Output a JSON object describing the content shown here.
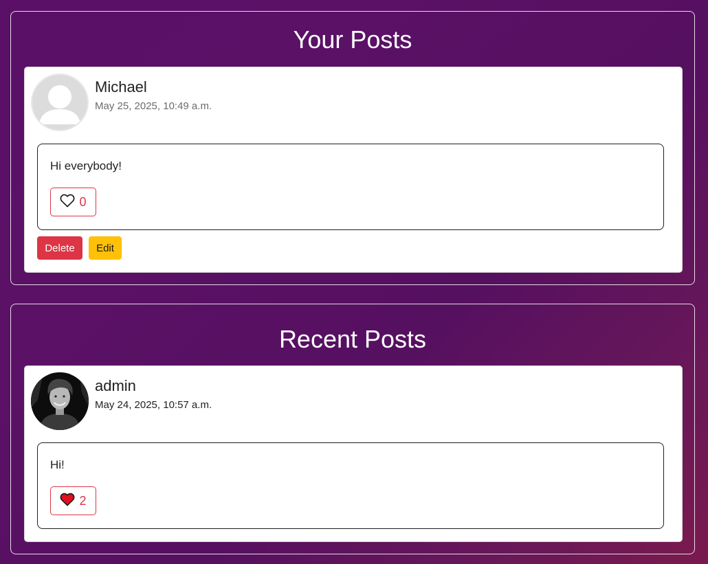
{
  "your_posts": {
    "title": "Your Posts",
    "post": {
      "author": "Michael",
      "timestamp": "May 25, 2025, 10:49 a.m.",
      "body": "Hi everybody!",
      "likes": "0",
      "liked": false,
      "avatar": "default-user-avatar",
      "delete_label": "Delete",
      "edit_label": "Edit"
    }
  },
  "recent_posts": {
    "title": "Recent Posts",
    "post": {
      "author": "admin",
      "timestamp": "May 24, 2025, 10:57 a.m.",
      "body": "Hi!",
      "likes": "2",
      "liked": true,
      "avatar": "user-photo-avatar"
    }
  },
  "colors": {
    "danger": "#dc3545",
    "warning": "#ffc107",
    "background": "#5a1066"
  }
}
